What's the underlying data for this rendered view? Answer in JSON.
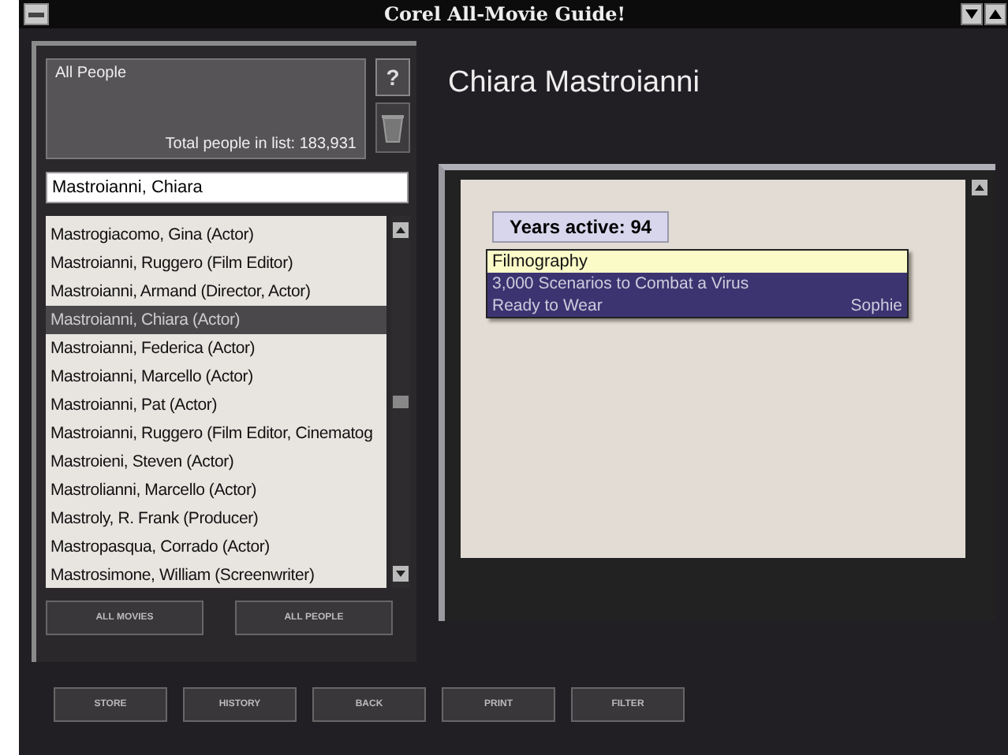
{
  "window": {
    "title": "Corel All-Movie Guide!"
  },
  "info": {
    "label": "All People",
    "total": "Total people in list: 183,931",
    "help_button": "?"
  },
  "search": {
    "value": "Mastroianni, Chiara"
  },
  "people": [
    {
      "name": "Mastrogiacomo, Gina (Actor)",
      "selected": false
    },
    {
      "name": "Mastroianni, Ruggero (Film Editor)",
      "selected": false
    },
    {
      "name": "Mastroianni, Armand (Director, Actor)",
      "selected": false
    },
    {
      "name": "Mastroianni, Chiara (Actor)",
      "selected": true
    },
    {
      "name": "Mastroianni, Federica (Actor)",
      "selected": false
    },
    {
      "name": "Mastroianni, Marcello (Actor)",
      "selected": false
    },
    {
      "name": "Mastroianni, Pat (Actor)",
      "selected": false
    },
    {
      "name": "Mastroianni, Ruggero (Film Editor, Cinematog",
      "selected": false
    },
    {
      "name": "Mastroieni, Steven (Actor)",
      "selected": false
    },
    {
      "name": "Mastrolianni, Marcello (Actor)",
      "selected": false
    },
    {
      "name": "Mastroly, R. Frank (Producer)",
      "selected": false
    },
    {
      "name": "Mastropasqua, Corrado (Actor)",
      "selected": false
    },
    {
      "name": "Mastrosimone, William (Screenwriter)",
      "selected": false
    }
  ],
  "list_buttons": [
    "ALL MOVIES",
    "ALL PEOPLE"
  ],
  "person": {
    "name": "Chiara Mastroianni",
    "years_active": "Years active: 94",
    "filmography": {
      "heading": "Filmography",
      "rows": [
        {
          "title": "3,000 Scenarios to Combat a Virus"
        },
        {
          "title": "Ready to Wear",
          "role": "Sophie"
        }
      ]
    }
  },
  "toolbar": [
    "STORE",
    "HISTORY",
    "BACK",
    "PRINT",
    "FILTER"
  ]
}
